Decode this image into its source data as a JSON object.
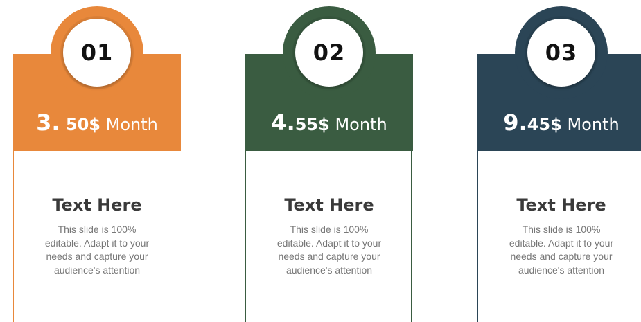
{
  "cards": [
    {
      "number": "01",
      "price_main": "3.",
      "price_cents": " 50$",
      "price_unit": " Month",
      "title": "Text Here",
      "description": "This slide is 100% editable. Adapt it to your needs and capture your audience's attention",
      "color": "#E8883B"
    },
    {
      "number": "02",
      "price_main": "4.",
      "price_cents": "55$",
      "price_unit": " Month",
      "title": "Text Here",
      "description": "This slide is 100% editable. Adapt it to your needs and capture your audience's attention",
      "color": "#3A5C41"
    },
    {
      "number": "03",
      "price_main": "9.",
      "price_cents": "45$",
      "price_unit": " Month",
      "title": "Text Here",
      "description": "This slide is 100% editable. Adapt it to your needs and capture your audience's attention",
      "color": "#2B4556"
    }
  ]
}
